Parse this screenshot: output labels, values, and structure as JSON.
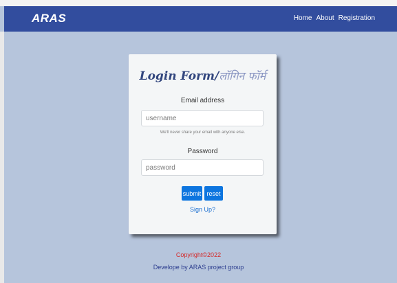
{
  "navbar": {
    "brand": "ARAS",
    "links": [
      "Home",
      "About",
      "Registration"
    ]
  },
  "form": {
    "title": "Login Form/",
    "title_hindi": "लॉगिन फॉर्म",
    "email_label": "Email address",
    "email_placeholder": "username",
    "email_help": "We'll never share your email with anyone else.",
    "password_label": "Password",
    "password_placeholder": "password",
    "submit_label": "submit",
    "reset_label": "reset",
    "signup_label": "Sign Up?"
  },
  "footer": {
    "copyright": "Copyright©2022",
    "developer": "Develope by ARAS project group"
  },
  "colors": {
    "navbar": "#324d9e",
    "page_background": "#b6c5dc",
    "button": "#0d75df",
    "copyright_text": "#d42a2a",
    "developer_text": "#2b3c8e"
  }
}
